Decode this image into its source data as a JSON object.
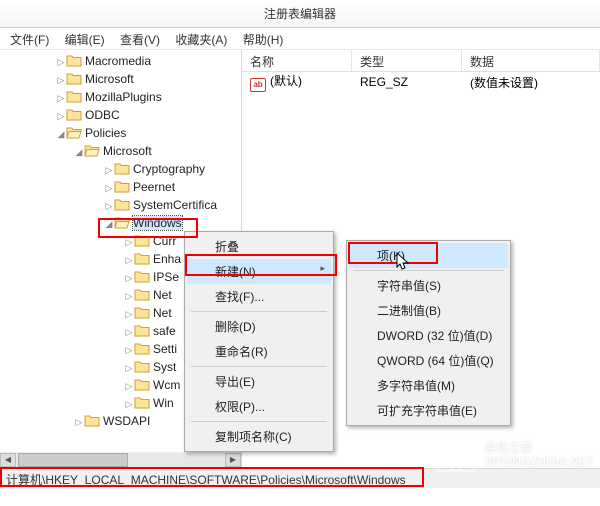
{
  "title": "注册表编辑器",
  "menus": {
    "file": "文件(F)",
    "edit": "编辑(E)",
    "view": "查看(V)",
    "fav": "收藏夹(A)",
    "help": "帮助(H)"
  },
  "tree": {
    "n0": "Macromedia",
    "n1": "Microsoft",
    "n2": "MozillaPlugins",
    "n3": "ODBC",
    "n4": "Policies",
    "n5": "Microsoft",
    "n6": "Cryptography",
    "n7": "Peernet",
    "n8": "SystemCertifica",
    "n9": "Windows",
    "n10": "Curr",
    "n11": "Enha",
    "n12": "IPSe",
    "n13": "Net",
    "n14": "Net",
    "n15": "safe",
    "n16": "Setti",
    "n17": "Syst",
    "n18": "Wcm",
    "n19": "Win",
    "n20": "WSDAPI"
  },
  "cols": {
    "name": "名称",
    "type": "类型",
    "data": "数据"
  },
  "row": {
    "name": "(默认)",
    "type": "REG_SZ",
    "data": "(数值未设置)"
  },
  "ctx1": {
    "collapse": "折叠",
    "new": "新建(N)",
    "find": "查找(F)...",
    "delete": "删除(D)",
    "rename": "重命名(R)",
    "export": "导出(E)",
    "perm": "权限(P)...",
    "copykey": "复制项名称(C)"
  },
  "ctx2": {
    "key": "项(K)",
    "string": "字符串值(S)",
    "binary": "二进制值(B)",
    "dword": "DWORD (32 位)值(D)",
    "qword": "QWORD (64 位)值(Q)",
    "multi": "多字符串值(M)",
    "expand": "可扩充字符串值(E)"
  },
  "status": "计算机\\HKEY_LOCAL_MACHINE\\SOFTWARE\\Policies\\Microsoft\\Windows",
  "watermark": {
    "l1": "系统之家",
    "l2": "XITONGZHIJIA.NET"
  }
}
